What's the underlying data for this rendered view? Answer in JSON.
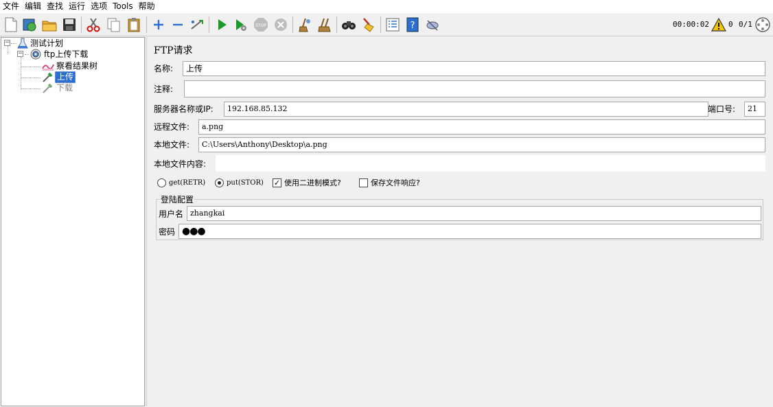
{
  "menu": [
    "文件",
    "编辑",
    "查找",
    "运行",
    "选项",
    "Tools",
    "帮助"
  ],
  "toolbar": {
    "timer": "00:00:02",
    "warnings": "0",
    "threads": "0/1"
  },
  "tree": {
    "root": "测试计划",
    "group": "ftp上传下载",
    "listener": "察看结果树",
    "upload": "上传",
    "download": "下载"
  },
  "form": {
    "title": "FTP请求",
    "name_label": "名称:",
    "name_value": "上传",
    "comment_label": "注释:",
    "comment_value": "",
    "server_label": "服务器名称或IP:",
    "server_value": "192.168.85.132",
    "port_label": "端口号:",
    "port_value": "21",
    "remote_label": "远程文件:",
    "remote_value": "a.png",
    "local_label": "本地文件:",
    "local_value": "C:\\Users\\Anthony\\Desktop\\a.png",
    "content_label": "本地文件内容:",
    "content_value": "",
    "get_label": "get(RETR)",
    "put_label": "put(STOR)",
    "mode": "put",
    "binary_label": "使用二进制模式?",
    "binary_checked": true,
    "save_label": "保存文件响应?",
    "save_checked": false
  },
  "login": {
    "group_title": "登陆配置",
    "user_label": "用户名",
    "user_value": "zhangkai",
    "pass_label": "密码",
    "pass_value": "●●●"
  },
  "colors": {
    "selection": "#2a6ed1",
    "warning": "#f5c400",
    "run": "#1a9a2a"
  }
}
